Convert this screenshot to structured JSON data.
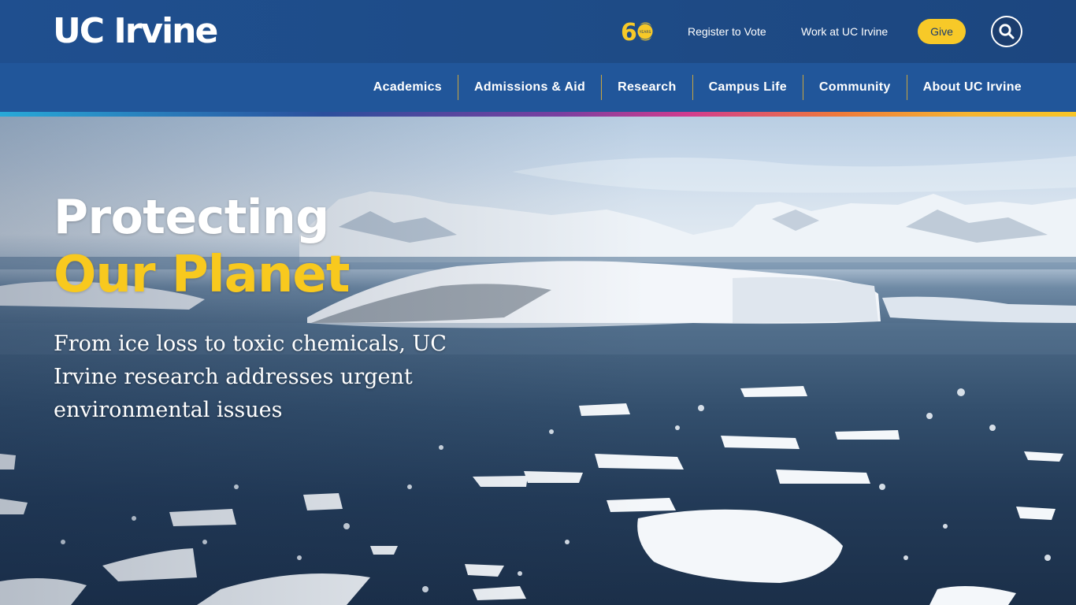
{
  "header": {
    "logo_text": "UC Irvine",
    "anniversary_badge": {
      "number": "60",
      "label": "YEARS"
    },
    "utility_links": [
      "Register to Vote",
      "Work at UC Irvine"
    ],
    "give_label": "Give",
    "search_icon": "search-icon"
  },
  "nav": {
    "items": [
      "Academics",
      "Admissions & Aid",
      "Research",
      "Campus Life",
      "Community",
      "About UC Irvine"
    ]
  },
  "hero": {
    "title_line1": "Protecting",
    "title_line2": "Our Planet",
    "subtitle": "From ice loss to toxic chemicals, UC Irvine research addresses urgent environmental issues"
  },
  "colors": {
    "brand_blue": "#1f4f8f",
    "nav_blue": "#21569a",
    "gold": "#f8c91e",
    "white": "#ffffff"
  }
}
